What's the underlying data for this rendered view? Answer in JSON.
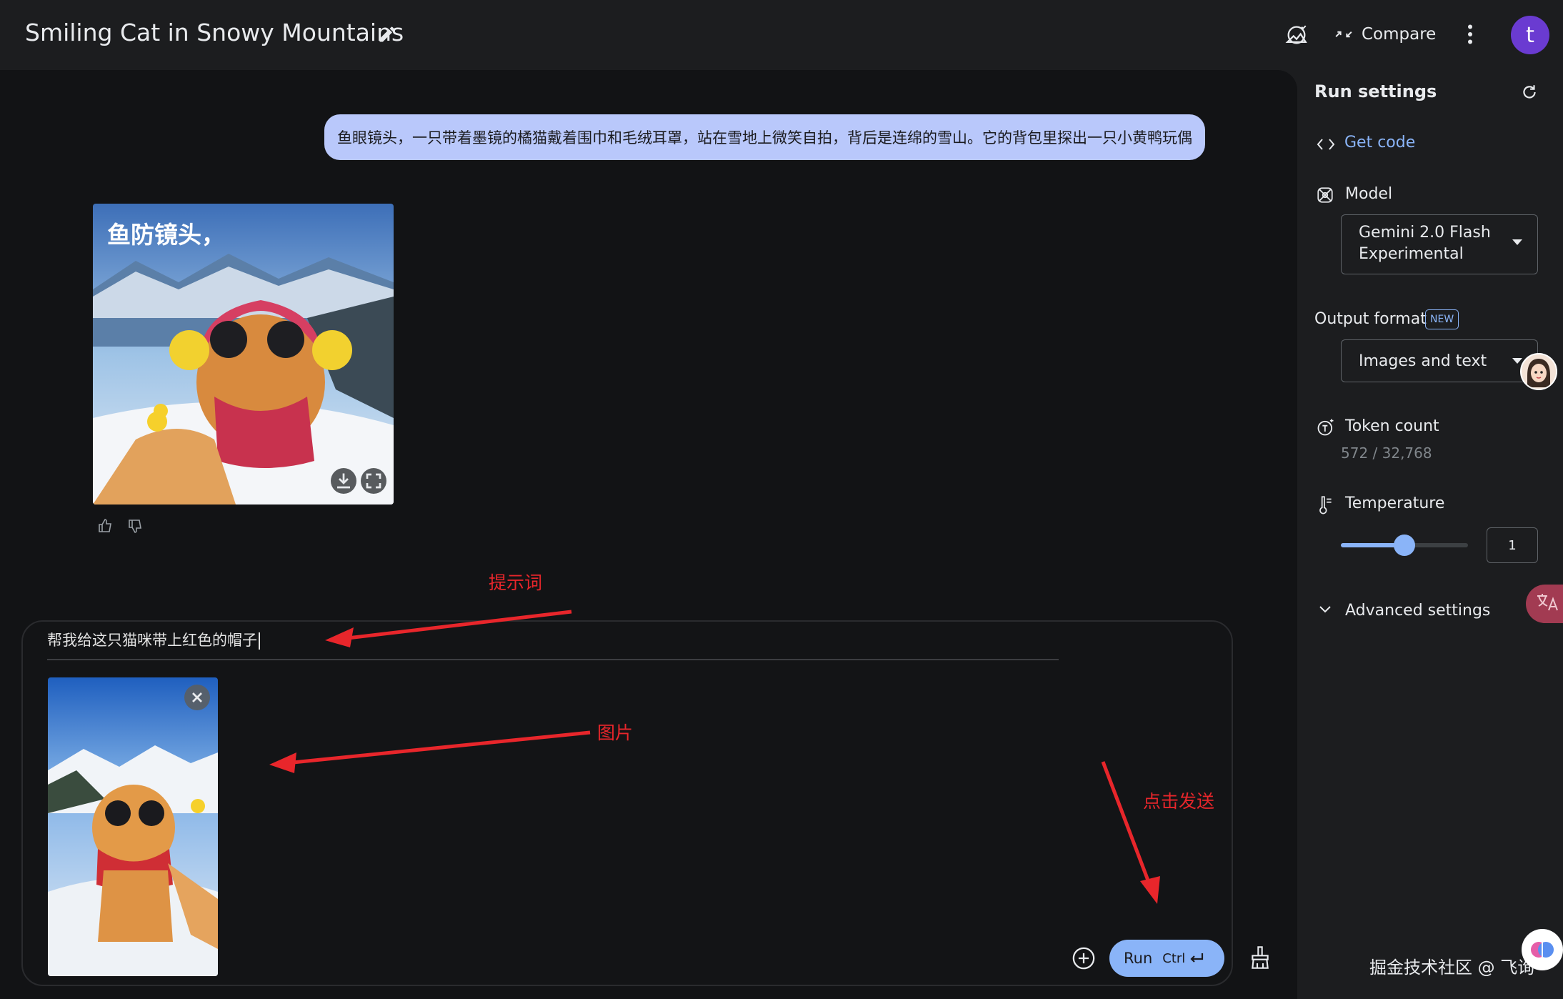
{
  "header": {
    "title": "Smiling Cat in Snowy Mountains",
    "compare_label": "Compare",
    "avatar_letter": "t"
  },
  "chat": {
    "user_prompt": "鱼眼镜头，一只带着墨镜的橘猫戴着围巾和毛绒耳罩，站在雪地上微笑自拍，背后是连绵的雪山。它的背包里探出一只小黄鸭玩偶",
    "generated_image_caption": "鱼防镜头，"
  },
  "input": {
    "prompt_text": "帮我给这只猫咪带上红色的帽子",
    "run_label": "Run",
    "run_shortcut": "Ctrl"
  },
  "annotations": {
    "prompt_note": "提示词",
    "image_note": "图片",
    "run_note": "点击发送"
  },
  "settings": {
    "title": "Run settings",
    "get_code": "Get code",
    "model_label": "Model",
    "model_value_line1": "Gemini 2.0 Flash",
    "model_value_line2": "Experimental",
    "output_format_label": "Output format",
    "new_badge": "NEW",
    "output_format_value": "Images and text",
    "token_label": "Token count",
    "token_value": "572 / 32,768",
    "temperature_label": "Temperature",
    "temperature_value": "1",
    "temperature_fraction": 0.5,
    "advanced_label": "Advanced settings"
  },
  "watermark": "掘金技术社区 @ 飞询",
  "colors": {
    "accent": "#8ab4f8",
    "user_bubble": "#b9c8fb",
    "annotation": "#e8262b",
    "avatar": "#6a3bd1"
  }
}
